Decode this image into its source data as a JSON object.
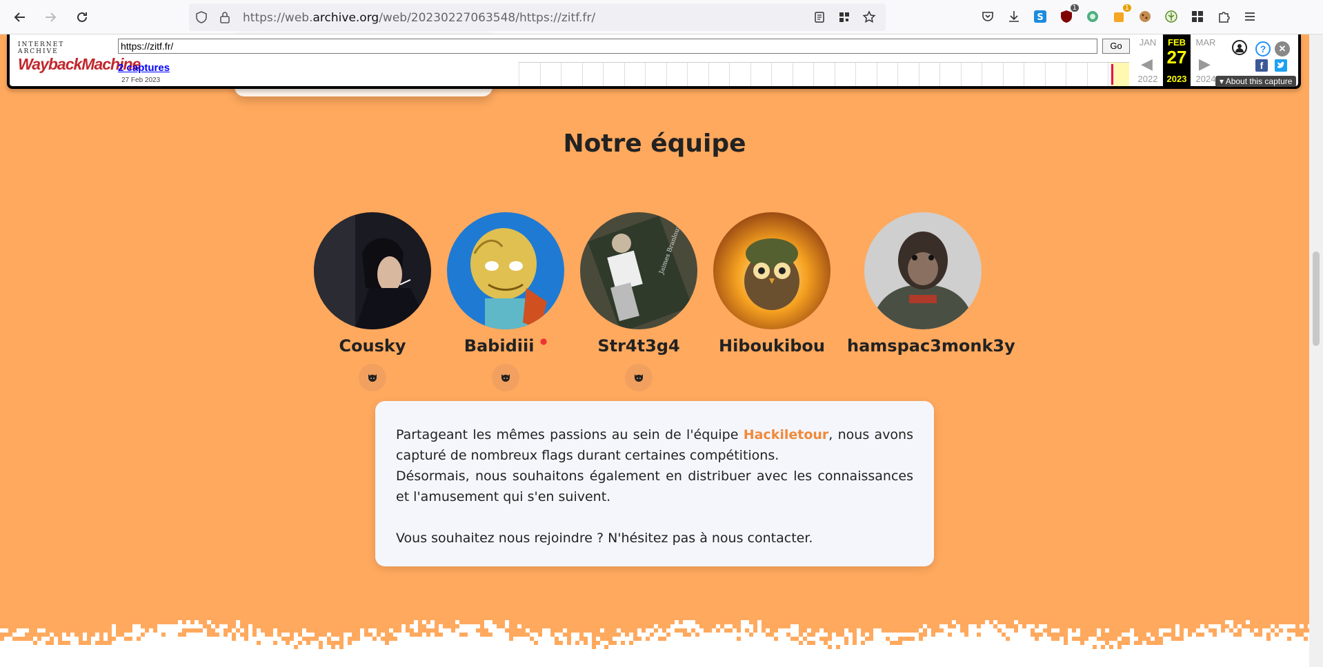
{
  "browser": {
    "url_prefix": "https://web.",
    "url_host": "archive.org",
    "url_path": "/web/20230227063548/https://zitf.fr/",
    "badges": {
      "ublock": "1",
      "ext_orange": "1"
    }
  },
  "wayback": {
    "ia_label": "INTERNET ARCHIVE",
    "logo_text": "WaybackMachine",
    "url_value": "https://zitf.fr/",
    "go_label": "Go",
    "captures_label": "2 captures",
    "captures_date": "27 Feb 2023",
    "prev_month": "JAN",
    "cur_month": "FEB",
    "next_month": "MAR",
    "cur_day": "27",
    "prev_year": "2022",
    "cur_year": "2023",
    "next_year": "2024",
    "about_label": "About this capture"
  },
  "team": {
    "title": "Notre équipe",
    "members": [
      {
        "name": "Cousky",
        "has_github": true
      },
      {
        "name": "Babidiii",
        "has_github": true
      },
      {
        "name": "Str4t3g4",
        "has_github": true
      },
      {
        "name": "Hiboukibou",
        "has_github": false
      },
      {
        "name": "hamspac3monk3y",
        "has_github": false
      }
    ]
  },
  "about": {
    "p1_before": "Partageant les mêmes passions au sein de l'équipe ",
    "team_name": "Hackiletour",
    "p1_after": ", nous avons capturé de nombreux flags durant certaines compétitions.",
    "p2": "Désormais, nous souhaitons également en distribuer avec les connaissances et l'amusement qui s'en suivent.",
    "p3": "Vous souhaitez nous rejoindre ? N'hésitez pas à nous contacter."
  },
  "colors": {
    "page_bg": "#ffa95e",
    "accent": "#f0893a",
    "card_bg": "#f4f6fb"
  }
}
